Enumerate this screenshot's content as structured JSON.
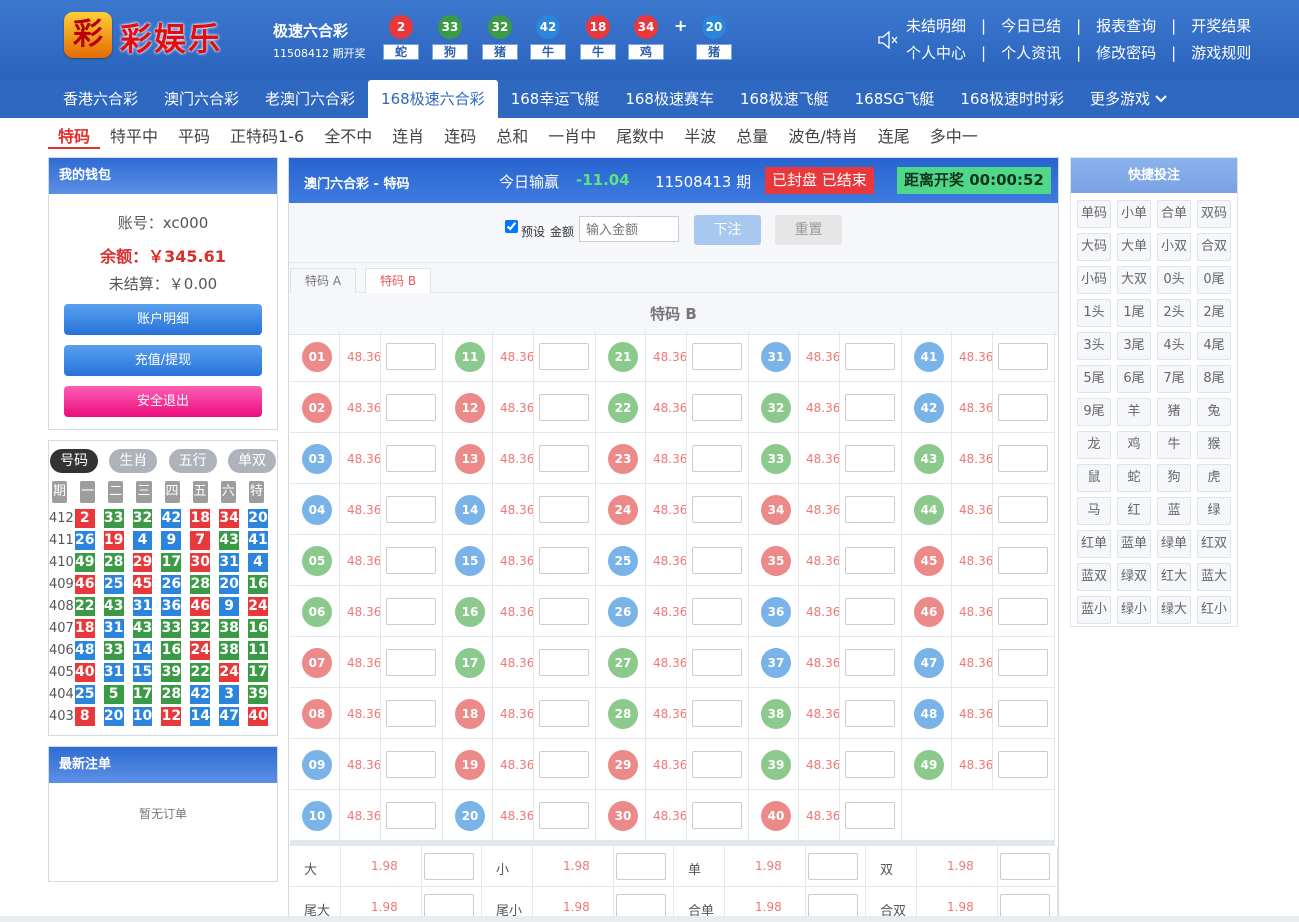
{
  "brand": {
    "mark": "彩",
    "name": "彩娱乐"
  },
  "lottery": {
    "title": "极速六合彩",
    "issue": "11508412 期开奖",
    "balls": [
      {
        "num": "2",
        "zod": "蛇",
        "color": "#e8383b"
      },
      {
        "num": "33",
        "zod": "狗",
        "color": "#3b9a46"
      },
      {
        "num": "32",
        "zod": "猪",
        "color": "#3b9a46"
      },
      {
        "num": "42",
        "zod": "牛",
        "color": "#2b85dc"
      },
      {
        "num": "18",
        "zod": "牛",
        "color": "#e8383b"
      },
      {
        "num": "34",
        "zod": "鸡",
        "color": "#e8383b"
      }
    ],
    "plus": "+",
    "special": {
      "num": "20",
      "zod": "猪",
      "color": "#2b85dc"
    }
  },
  "toplinks": [
    [
      "未结明细",
      "今日已结",
      "报表查询",
      "开奖结果"
    ],
    [
      "个人中心",
      "个人资讯",
      "修改密码",
      "游戏规则"
    ]
  ],
  "nav": [
    "香港六合彩",
    "澳门六合彩",
    "老澳门六合彩",
    "168极速六合彩",
    "168幸运飞艇",
    "168极速赛车",
    "168极速飞艇",
    "168SG飞艇",
    "168极速时时彩",
    "更多游戏"
  ],
  "nav_active": 3,
  "subnav": [
    "特码",
    "特平中",
    "平码",
    "正特码1-6",
    "全不中",
    "连肖",
    "连码",
    "总和",
    "一肖中",
    "尾数中",
    "半波",
    "总量",
    "波色/特肖",
    "连尾",
    "多中一"
  ],
  "wallet": {
    "title": "我的钱包",
    "account": "账号：xc000",
    "balance": "余额：￥345.61",
    "unsettled": "未结算：￥0.00",
    "btn_detail": "账户明细",
    "btn_recharge": "充值/提现",
    "btn_logout": "安全退出"
  },
  "history": {
    "tabs": [
      "号码",
      "生肖",
      "五行",
      "单双"
    ],
    "head": [
      "期",
      "一",
      "二",
      "三",
      "四",
      "五",
      "六",
      "特"
    ],
    "rows": [
      {
        "p": "412",
        "n": [
          [
            "2",
            "r"
          ],
          [
            "33",
            "g"
          ],
          [
            "32",
            "g"
          ],
          [
            "42",
            "b"
          ],
          [
            "18",
            "r"
          ],
          [
            "34",
            "r"
          ],
          [
            "20",
            "b"
          ]
        ]
      },
      {
        "p": "411",
        "n": [
          [
            "26",
            "b"
          ],
          [
            "19",
            "r"
          ],
          [
            "4",
            "b"
          ],
          [
            "9",
            "b"
          ],
          [
            "7",
            "r"
          ],
          [
            "43",
            "g"
          ],
          [
            "41",
            "b"
          ]
        ]
      },
      {
        "p": "410",
        "n": [
          [
            "49",
            "g"
          ],
          [
            "28",
            "g"
          ],
          [
            "29",
            "r"
          ],
          [
            "17",
            "g"
          ],
          [
            "30",
            "r"
          ],
          [
            "31",
            "b"
          ],
          [
            "4",
            "b"
          ]
        ]
      },
      {
        "p": "409",
        "n": [
          [
            "46",
            "r"
          ],
          [
            "25",
            "b"
          ],
          [
            "45",
            "r"
          ],
          [
            "26",
            "b"
          ],
          [
            "28",
            "g"
          ],
          [
            "20",
            "b"
          ],
          [
            "16",
            "g"
          ]
        ]
      },
      {
        "p": "408",
        "n": [
          [
            "22",
            "g"
          ],
          [
            "43",
            "g"
          ],
          [
            "31",
            "b"
          ],
          [
            "36",
            "b"
          ],
          [
            "46",
            "r"
          ],
          [
            "9",
            "b"
          ],
          [
            "24",
            "r"
          ]
        ]
      },
      {
        "p": "407",
        "n": [
          [
            "18",
            "r"
          ],
          [
            "31",
            "b"
          ],
          [
            "43",
            "g"
          ],
          [
            "33",
            "g"
          ],
          [
            "32",
            "g"
          ],
          [
            "38",
            "g"
          ],
          [
            "16",
            "g"
          ]
        ]
      },
      {
        "p": "406",
        "n": [
          [
            "48",
            "b"
          ],
          [
            "33",
            "g"
          ],
          [
            "14",
            "b"
          ],
          [
            "16",
            "g"
          ],
          [
            "24",
            "r"
          ],
          [
            "38",
            "g"
          ],
          [
            "11",
            "g"
          ]
        ]
      },
      {
        "p": "405",
        "n": [
          [
            "40",
            "r"
          ],
          [
            "31",
            "b"
          ],
          [
            "15",
            "b"
          ],
          [
            "39",
            "g"
          ],
          [
            "22",
            "g"
          ],
          [
            "24",
            "r"
          ],
          [
            "17",
            "g"
          ]
        ]
      },
      {
        "p": "404",
        "n": [
          [
            "25",
            "b"
          ],
          [
            "5",
            "g"
          ],
          [
            "17",
            "g"
          ],
          [
            "28",
            "g"
          ],
          [
            "42",
            "b"
          ],
          [
            "3",
            "b"
          ],
          [
            "39",
            "g"
          ]
        ]
      },
      {
        "p": "403",
        "n": [
          [
            "8",
            "r"
          ],
          [
            "20",
            "b"
          ],
          [
            "10",
            "b"
          ],
          [
            "12",
            "r"
          ],
          [
            "14",
            "b"
          ],
          [
            "47",
            "b"
          ],
          [
            "40",
            "r"
          ]
        ]
      }
    ]
  },
  "latest": {
    "title": "最新注单",
    "empty": "暂无订单"
  },
  "main": {
    "title": "澳门六合彩 - 特码",
    "winlose_label": "今日输赢",
    "winlose": "-11.04",
    "issue": "11508413 期",
    "status": "已封盘 已结束",
    "countdown": "距离开奖 00:00:52",
    "preset": "预设",
    "amount_label": "金额",
    "amount_placeholder": "输入金额",
    "submit": "下注",
    "reset": "重置",
    "tabs": [
      "特码 A",
      "特码 B"
    ],
    "section": "特码 B",
    "odds": "48.36",
    "numbers": [
      [
        "01",
        "r"
      ],
      [
        "02",
        "r"
      ],
      [
        "03",
        "b"
      ],
      [
        "04",
        "b"
      ],
      [
        "05",
        "g"
      ],
      [
        "06",
        "g"
      ],
      [
        "07",
        "r"
      ],
      [
        "08",
        "r"
      ],
      [
        "09",
        "b"
      ],
      [
        "10",
        "b"
      ],
      [
        "11",
        "g"
      ],
      [
        "12",
        "r"
      ],
      [
        "13",
        "r"
      ],
      [
        "14",
        "b"
      ],
      [
        "15",
        "b"
      ],
      [
        "16",
        "g"
      ],
      [
        "17",
        "g"
      ],
      [
        "18",
        "r"
      ],
      [
        "19",
        "r"
      ],
      [
        "20",
        "b"
      ],
      [
        "21",
        "g"
      ],
      [
        "22",
        "g"
      ],
      [
        "23",
        "r"
      ],
      [
        "24",
        "r"
      ],
      [
        "25",
        "b"
      ],
      [
        "26",
        "b"
      ],
      [
        "27",
        "g"
      ],
      [
        "28",
        "g"
      ],
      [
        "29",
        "r"
      ],
      [
        "30",
        "r"
      ],
      [
        "31",
        "b"
      ],
      [
        "32",
        "g"
      ],
      [
        "33",
        "g"
      ],
      [
        "34",
        "r"
      ],
      [
        "35",
        "r"
      ],
      [
        "36",
        "b"
      ],
      [
        "37",
        "b"
      ],
      [
        "38",
        "g"
      ],
      [
        "39",
        "g"
      ],
      [
        "40",
        "r"
      ],
      [
        "41",
        "b"
      ],
      [
        "42",
        "b"
      ],
      [
        "43",
        "g"
      ],
      [
        "44",
        "g"
      ],
      [
        "45",
        "r"
      ],
      [
        "46",
        "r"
      ],
      [
        "47",
        "b"
      ],
      [
        "48",
        "b"
      ],
      [
        "49",
        "g"
      ]
    ],
    "extra": [
      [
        [
          "大",
          "1.98"
        ],
        [
          "小",
          "1.98"
        ],
        [
          "单",
          "1.98"
        ],
        [
          "双",
          "1.98"
        ]
      ],
      [
        [
          "尾大",
          "1.98"
        ],
        [
          "尾小",
          "1.98"
        ],
        [
          "合单",
          "1.98"
        ],
        [
          "合双",
          "1.98"
        ]
      ]
    ]
  },
  "quick": {
    "title": "快捷投注",
    "items": [
      "单码",
      "小单",
      "合单",
      "双码",
      "大码",
      "大单",
      "小双",
      "合双",
      "小码",
      "大双",
      "0头",
      "0尾",
      "1头",
      "1尾",
      "2头",
      "2尾",
      "3头",
      "3尾",
      "4头",
      "4尾",
      "5尾",
      "6尾",
      "7尾",
      "8尾",
      "9尾",
      "羊",
      "猪",
      "兔",
      "龙",
      "鸡",
      "牛",
      "猴",
      "鼠",
      "蛇",
      "狗",
      "虎",
      "马",
      "红",
      "蓝",
      "绿",
      "红单",
      "蓝单",
      "绿单",
      "红双",
      "蓝双",
      "绿双",
      "红大",
      "蓝大",
      "蓝小",
      "绿小",
      "绿大",
      "红小"
    ]
  },
  "colors": {
    "r": "#e8383b",
    "g": "#3b9a46",
    "b": "#2b85dc",
    "ballr": "#ec8a8a",
    "ballg": "#8cc98c",
    "ballb": "#7ab3e8"
  }
}
